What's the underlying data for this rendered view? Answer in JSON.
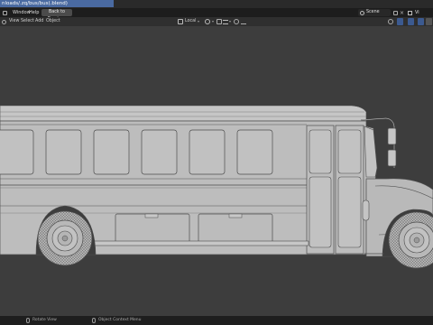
{
  "window": {
    "title": "nloads/.zq/bus/bus(.blend)"
  },
  "topbar": {
    "menu": [
      "Window",
      "Help"
    ],
    "back_to_previous": "Back to Previous",
    "scene": "Scene",
    "view_layer": "Vi"
  },
  "header": {
    "menu": [
      "View",
      "Select",
      "Add",
      "Object"
    ],
    "transform_orientation": "Local"
  },
  "statusbar": {
    "rotate_view": "Rotate View",
    "context_menu": "Object Context Menu"
  },
  "colors": {
    "accent": "#4a6aa1",
    "viewport_bg": "#3d3d3d",
    "mesh_fill": "#bcbcbc",
    "wire": "#4d4d4d"
  }
}
